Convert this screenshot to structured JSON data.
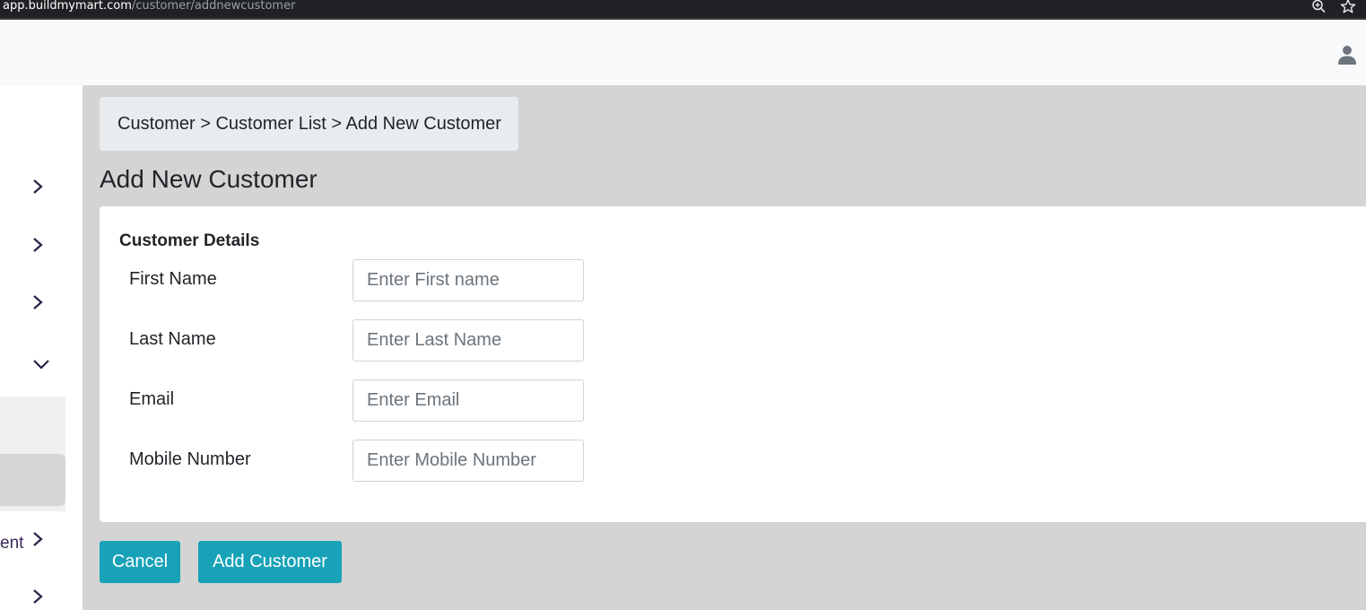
{
  "browser": {
    "url_domain": "app.buildmymart.com",
    "url_path": "/customer/addnewcustomer",
    "zoom_icon": "zoom-in-icon",
    "star_icon": "bookmark-star-icon"
  },
  "header": {
    "user_icon": "user-icon"
  },
  "sidebar": {
    "items": [
      {
        "icon": "chevron-right-icon"
      },
      {
        "icon": "chevron-right-icon"
      },
      {
        "icon": "chevron-right-icon"
      },
      {
        "icon": "chevron-down-icon"
      },
      {
        "label": "ent",
        "icon": "chevron-right-icon"
      },
      {
        "icon": "chevron-right-icon"
      }
    ]
  },
  "breadcrumb": {
    "text": "Customer > Customer List > Add New Customer"
  },
  "page": {
    "title": "Add New Customer"
  },
  "form": {
    "section_title": "Customer Details",
    "fields": [
      {
        "label": "First Name",
        "placeholder": "Enter First name",
        "value": ""
      },
      {
        "label": "Last Name",
        "placeholder": "Enter Last Name",
        "value": ""
      },
      {
        "label": "Email",
        "placeholder": "Enter Email",
        "value": ""
      },
      {
        "label": "Mobile Number",
        "placeholder": "Enter Mobile Number",
        "value": ""
      }
    ]
  },
  "actions": {
    "cancel_label": "Cancel",
    "add_label": "Add Customer"
  },
  "colors": {
    "primary_button": "#17a2b8",
    "content_bg": "#d4d4d4",
    "breadcrumb_bg": "#e9ecef"
  }
}
